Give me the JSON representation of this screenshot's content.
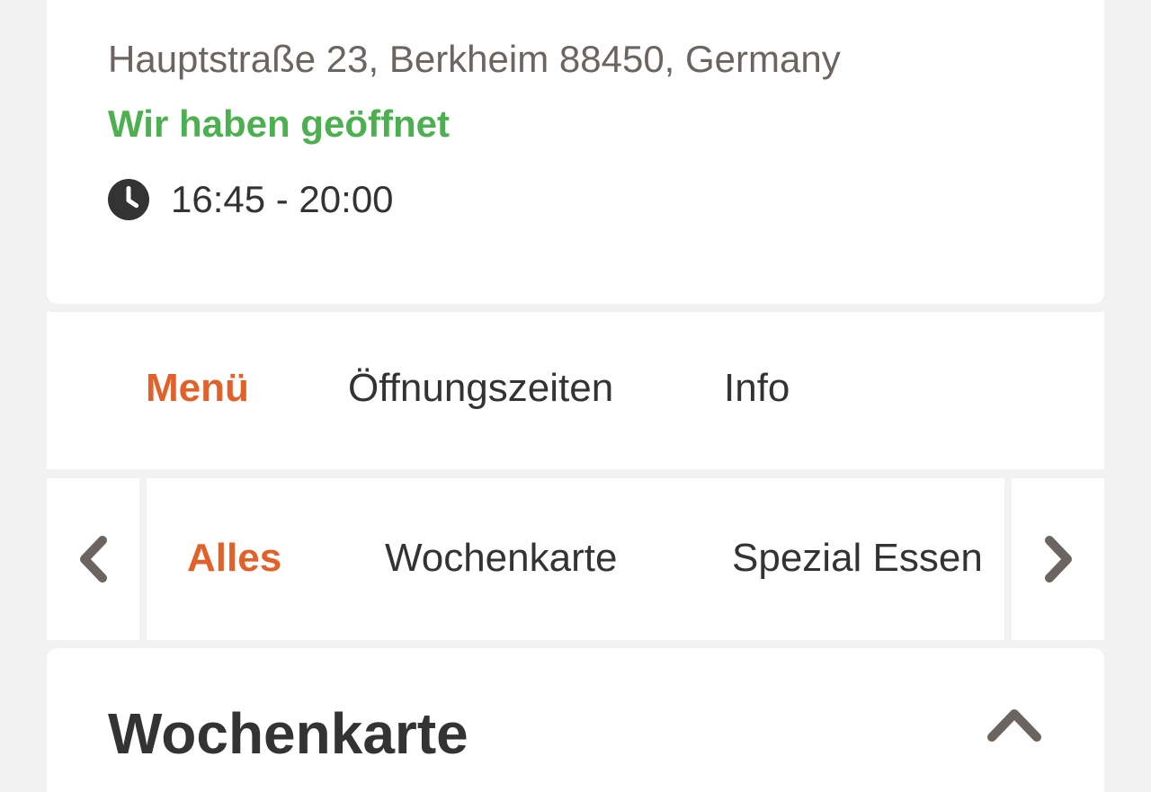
{
  "restaurant": {
    "address": "Hauptstraße 23, Berkheim 88450, Germany",
    "open_status": "Wir haben geöffnet",
    "hours": "16:45 - 20:00",
    "clock_icon": "clock-icon"
  },
  "tabs": [
    {
      "label": "Menü",
      "active": true
    },
    {
      "label": "Öffnungszeiten",
      "active": false
    },
    {
      "label": "Info",
      "active": false
    }
  ],
  "categories": {
    "prev_icon": "chevron-left-icon",
    "next_icon": "chevron-right-icon",
    "items": [
      {
        "label": "Alles",
        "active": true
      },
      {
        "label": "Wochenkarte",
        "active": false
      },
      {
        "label": "Spezial Essen",
        "active": false
      }
    ]
  },
  "section": {
    "title": "Wochenkarte",
    "toggle_icon": "chevron-up-icon"
  },
  "colors": {
    "accent": "#e0622a",
    "open_status": "#4caf50",
    "text": "#333333",
    "muted_text": "#6b6461",
    "background": "#f2f2f2",
    "card": "#ffffff"
  }
}
